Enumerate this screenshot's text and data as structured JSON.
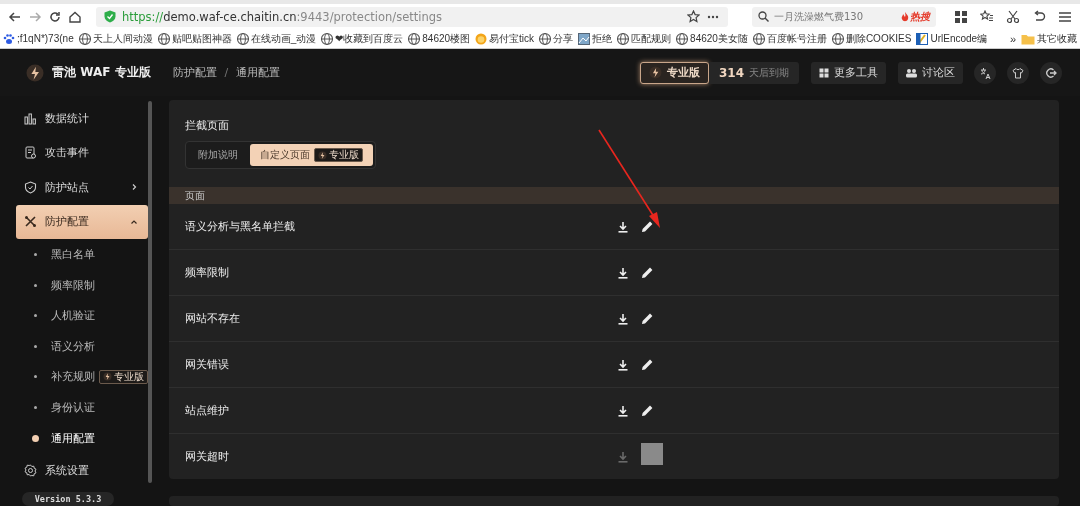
{
  "browser": {
    "url_scheme": "https://",
    "url_host": "demo.waf-ce.chaitin.cn",
    "url_rest": ":9443/protection/settings",
    "search_placeholder": "一月洗澡燃气费130",
    "search_badge": "热搜",
    "bookmarks": [
      {
        "label": ";f1qN*)73(ne"
      },
      {
        "label": "天上人间动漫"
      },
      {
        "label": "贴吧贴图神器"
      },
      {
        "label": "在线动画_动漫"
      },
      {
        "label": "❤收藏到百度云"
      },
      {
        "label": "84620楼图"
      },
      {
        "label": "易付宝tick"
      },
      {
        "label": "分享"
      },
      {
        "label": "拒绝"
      },
      {
        "label": "匹配规则"
      },
      {
        "label": "84620美女随"
      },
      {
        "label": "百度帐号注册"
      },
      {
        "label": "删除COOKIES"
      },
      {
        "label": "UrlEncode编"
      }
    ],
    "more": "»",
    "folder": "其它收藏"
  },
  "app": {
    "brand": "雷池 WAF 专业版",
    "breadcrumb": [
      "防护配置",
      "通用配置"
    ],
    "breadcrumb_separator": "/",
    "pro_label": "专业版",
    "days": "314",
    "days_suffix": "天后到期",
    "tools": [
      "更多工具",
      "讨论区"
    ]
  },
  "sidebar": {
    "items": [
      {
        "kind": "nav",
        "label": "数据统计",
        "selected": false
      },
      {
        "kind": "nav",
        "label": "攻击事件",
        "selected": false
      },
      {
        "kind": "nav",
        "label": "防护站点",
        "selected": false,
        "expanded": false
      },
      {
        "kind": "nav",
        "label": "防护配置",
        "selected": true,
        "expanded": true
      },
      {
        "kind": "sub",
        "label": "黑白名单",
        "selected": false
      },
      {
        "kind": "sub",
        "label": "频率限制",
        "selected": false
      },
      {
        "kind": "sub",
        "label": "人机验证",
        "selected": false
      },
      {
        "kind": "sub",
        "label": "语义分析",
        "selected": false
      },
      {
        "kind": "sub",
        "label": "补充规则",
        "selected": false,
        "badge": "专业版"
      },
      {
        "kind": "sub",
        "label": "身份认证",
        "selected": false
      },
      {
        "kind": "sub",
        "label": "通用配置",
        "selected": true
      },
      {
        "kind": "nav",
        "label": "系统设置",
        "selected": false
      }
    ],
    "version": "Version 5.3.3"
  },
  "panel": {
    "title": "拦截页面",
    "tabs": [
      {
        "label": "附加说明",
        "selected": false
      },
      {
        "label": "自定义页面",
        "selected": true,
        "badge": "专业版"
      }
    ],
    "section": "页面",
    "rows": [
      {
        "name": "语义分析与黑名单拦截",
        "obscured": false
      },
      {
        "name": "频率限制",
        "obscured": false
      },
      {
        "name": "网站不存在",
        "obscured": false
      },
      {
        "name": "网关错误",
        "obscured": false
      },
      {
        "name": "站点维护",
        "obscured": false
      },
      {
        "name": "网关超时",
        "obscured": true
      }
    ]
  }
}
